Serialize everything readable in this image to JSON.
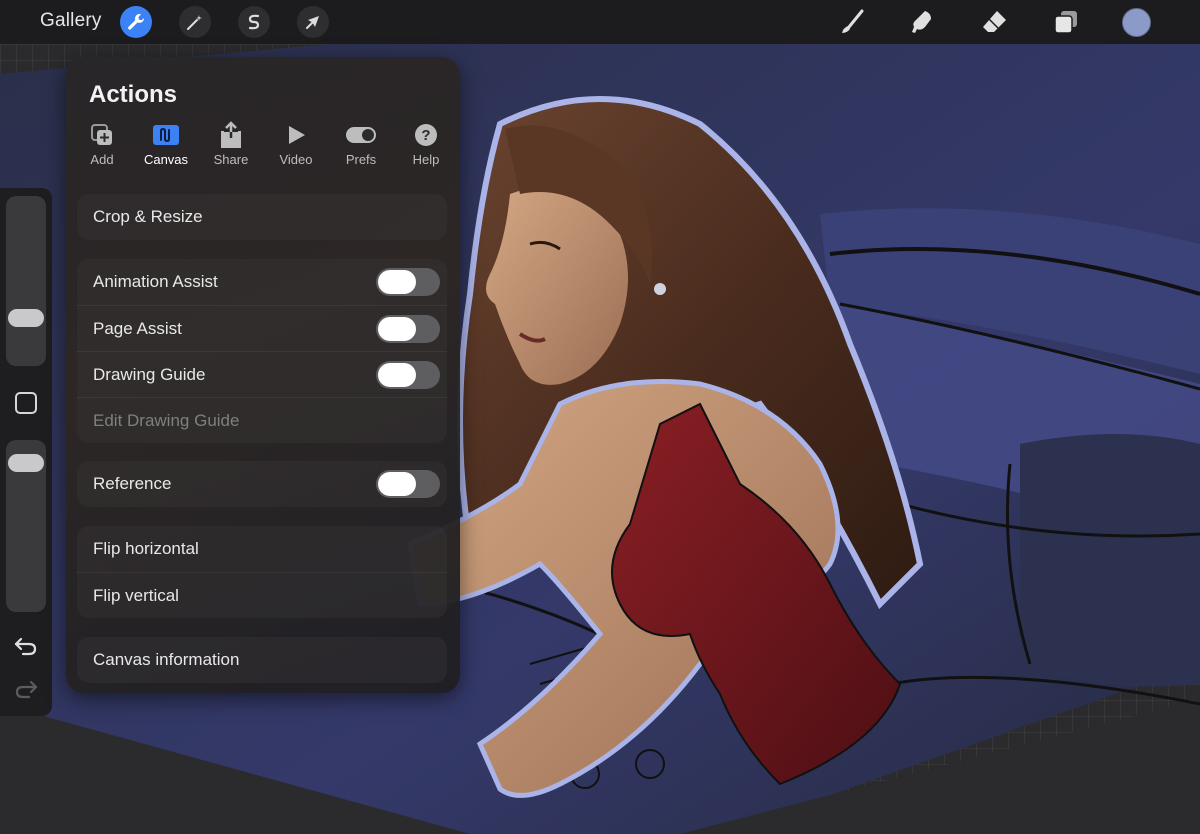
{
  "topbar": {
    "gallery_label": "Gallery",
    "tools": [
      {
        "name": "actions",
        "icon": "wrench-icon",
        "active": true
      },
      {
        "name": "adjustments",
        "icon": "magic-wand-icon",
        "active": false
      },
      {
        "name": "selection",
        "icon": "selection-s-icon",
        "active": false
      },
      {
        "name": "transform",
        "icon": "arrow-cursor-icon",
        "active": false
      }
    ],
    "right_tools": [
      "brush-icon",
      "smudge-icon",
      "eraser-icon",
      "layers-icon"
    ],
    "current_color": "#8c9ac7"
  },
  "actions_panel": {
    "title": "Actions",
    "tabs": [
      {
        "label": "Add",
        "icon": "add-icon"
      },
      {
        "label": "Canvas",
        "icon": "canvas-icon",
        "active": true
      },
      {
        "label": "Share",
        "icon": "share-icon"
      },
      {
        "label": "Video",
        "icon": "video-play-icon"
      },
      {
        "label": "Prefs",
        "icon": "prefs-toggle-icon"
      },
      {
        "label": "Help",
        "icon": "help-icon"
      }
    ],
    "crop_resize": "Crop & Resize",
    "assist": {
      "animation_assist": "Animation Assist",
      "page_assist": "Page Assist",
      "drawing_guide": "Drawing Guide",
      "edit_drawing_guide": "Edit Drawing Guide"
    },
    "reference": "Reference",
    "flip": {
      "horizontal": "Flip horizontal",
      "vertical": "Flip vertical"
    },
    "canvas_information": "Canvas information"
  },
  "sidebar": {
    "brush_size_level": 0.24,
    "opacity_level": 0.93
  },
  "colors": {
    "accent": "#3a82f6",
    "toggle_off": "#5e5e60"
  }
}
